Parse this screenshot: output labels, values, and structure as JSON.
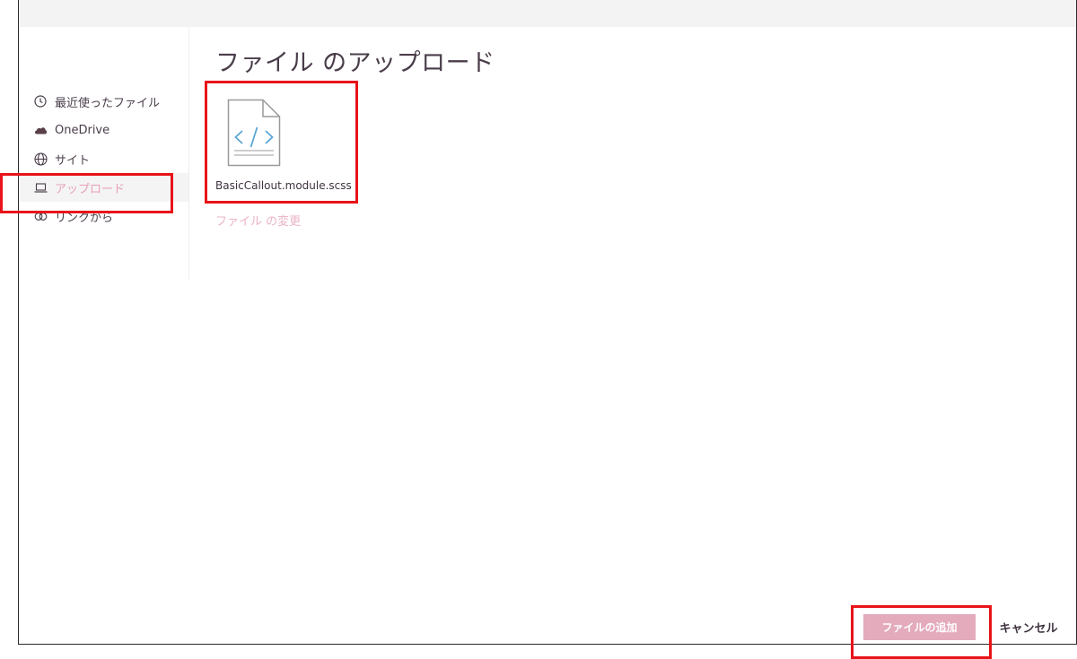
{
  "dialog": {
    "title": "ファイル のアップロード"
  },
  "sidebar": {
    "items": [
      {
        "label": "最近使ったファイル",
        "icon": "clock-icon"
      },
      {
        "label": "OneDrive",
        "icon": "cloud-icon"
      },
      {
        "label": "サイト",
        "icon": "globe-icon"
      },
      {
        "label": "アップロード",
        "icon": "laptop-icon",
        "active": true
      },
      {
        "label": "リンクから",
        "icon": "link-icon"
      }
    ]
  },
  "file": {
    "name": "BasicCallout.module.scss",
    "icon": "code-file-icon",
    "change_label": "ファイル の変更"
  },
  "footer": {
    "add_label": "ファイルの追加",
    "cancel_label": "キャンセル"
  },
  "colors": {
    "accent": "#e4abbd",
    "active_text": "#e8a0b8",
    "highlight": "#e8141a"
  }
}
